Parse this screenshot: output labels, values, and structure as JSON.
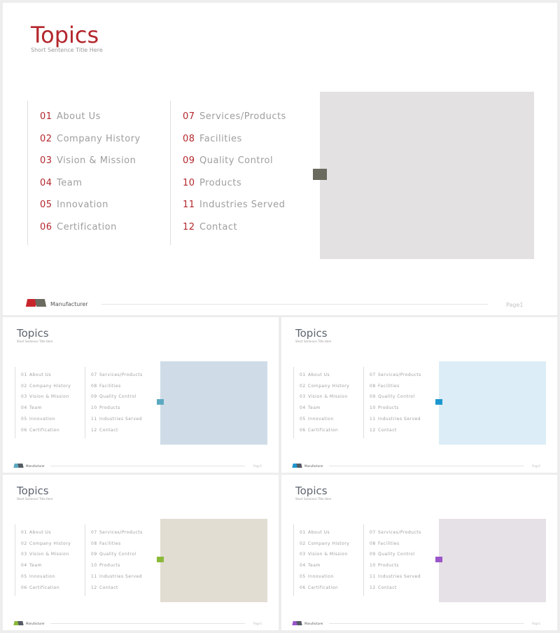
{
  "main": {
    "title": "Topics",
    "subtitle": "Short Sentence Title Here",
    "items": [
      {
        "num": "01",
        "label": "About Us"
      },
      {
        "num": "02",
        "label": "Company History"
      },
      {
        "num": "03",
        "label": "Vision & Mission"
      },
      {
        "num": "04",
        "label": "Team"
      },
      {
        "num": "05",
        "label": "Innovation"
      },
      {
        "num": "06",
        "label": "Certification"
      },
      {
        "num": "07",
        "label": "Services/Products"
      },
      {
        "num": "08",
        "label": "Facilities"
      },
      {
        "num": "09",
        "label": "Quality Control"
      },
      {
        "num": "10",
        "label": "Products"
      },
      {
        "num": "11",
        "label": "Industries Served"
      },
      {
        "num": "12",
        "label": "Contact"
      }
    ],
    "footer_brand": "Manufacturer",
    "page_label": "Page1"
  },
  "variants": [
    {
      "id": "blue",
      "accent": "#5ba9c0",
      "photo": "#cfdce8",
      "title": "Topics",
      "subtitle": "Short Sentence Title Here",
      "footer_brand": "Manufacturer",
      "page_label": "Page1"
    },
    {
      "id": "sky",
      "accent": "#1d97cf",
      "photo": "#dcedf7",
      "title": "Topics",
      "subtitle": "Short Sentence Title Here",
      "footer_brand": "Manufacturer",
      "page_label": "Page1"
    },
    {
      "id": "green",
      "accent": "#8aba3a",
      "photo": "#e2ddd2",
      "title": "Topics",
      "subtitle": "Short Sentence Title Here",
      "footer_brand": "Manufacturer",
      "page_label": "Page1"
    },
    {
      "id": "purple",
      "accent": "#9a55c9",
      "photo": "#e6e1e6",
      "title": "Topics",
      "subtitle": "Short Sentence Title Here",
      "footer_brand": "Manufacturer",
      "page_label": "Page1"
    }
  ],
  "colors": {
    "main_accent": "#b3272d",
    "main_photo": "#e3e1e2",
    "main_marker": "#6a6a5e"
  }
}
